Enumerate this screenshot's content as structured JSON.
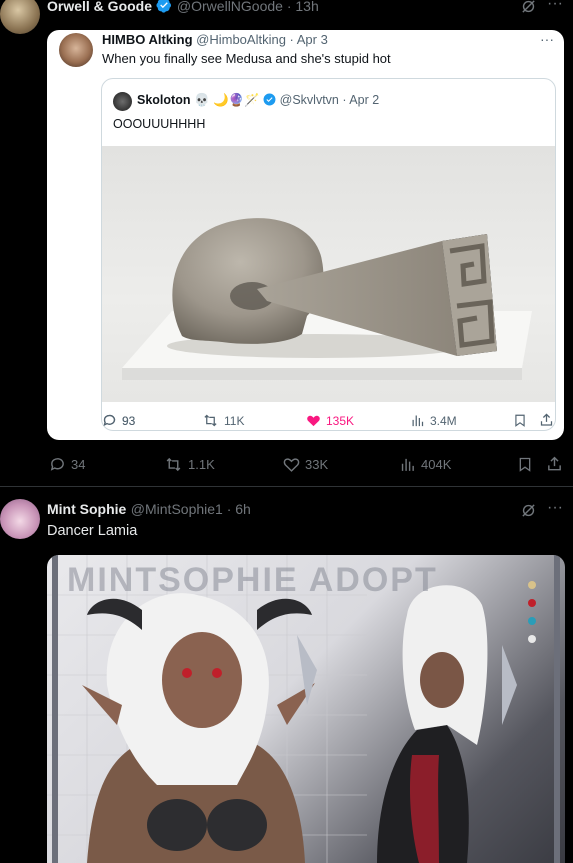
{
  "tweet1": {
    "author_name": "Orwell & Goode",
    "handle_time": "@OrwellNGoode · 13h",
    "actions": {
      "replies": "34",
      "reposts": "1.1K",
      "likes": "33K",
      "views": "404K"
    }
  },
  "quoted": {
    "author_name": "HIMBO Altking",
    "handle_time": "@HimboAltking · Apr 3",
    "text": "When you finally see Medusa and she's stupid hot",
    "more": "···",
    "inner": {
      "author_name": "Skoloton",
      "emoji": "💀 🌙🔮🪄",
      "handle_time": "@Skvlvtvn · Apr 2",
      "text": "OOOUUUHHHH"
    },
    "actions": {
      "replies": "93",
      "reposts": "11K",
      "likes": "135K",
      "views": "3.4M"
    }
  },
  "tweet2": {
    "author_name": "Mint Sophie",
    "handle_time": "@MintSophie1 · 6h",
    "text": "Dancer Lamia",
    "image_watermark": "MINTSOPHIE ADOPT"
  },
  "colors": {
    "verified": "#1d9bf0",
    "like": "#f91880",
    "muted": "#71767b"
  }
}
